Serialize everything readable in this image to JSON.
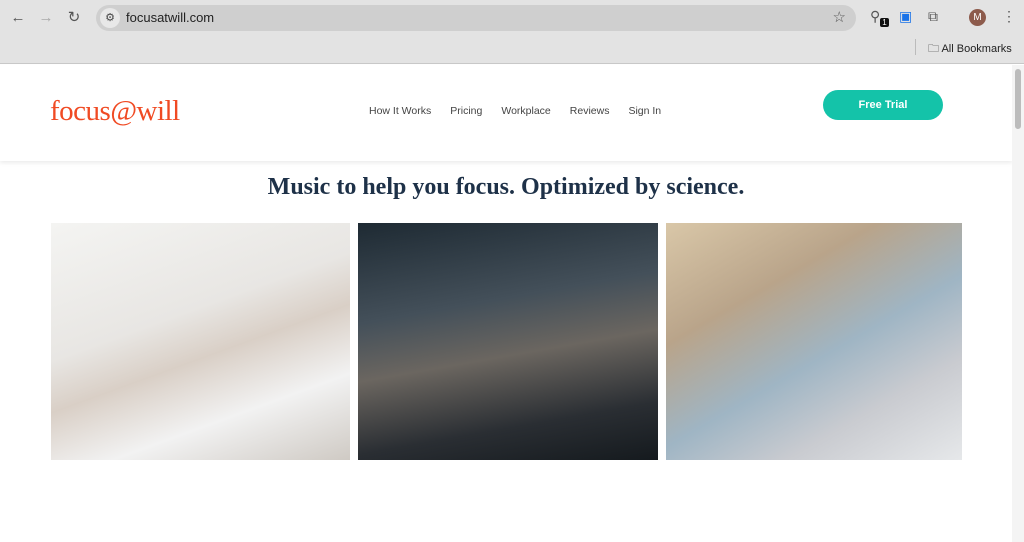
{
  "browser": {
    "url": "focusatwill.com",
    "extension_badge": "1",
    "profile_initial": "M",
    "bookmarks_label": "All Bookmarks"
  },
  "site": {
    "logo": "focus@will",
    "nav": [
      "How It Works",
      "Pricing",
      "Workplace",
      "Reviews",
      "Sign In"
    ],
    "cta": "Free Trial",
    "headline": "Music to help you focus. Optimized by science.",
    "colors": {
      "brand": "#f04a23",
      "cta": "#14c3a9",
      "headline": "#1e3148"
    }
  }
}
